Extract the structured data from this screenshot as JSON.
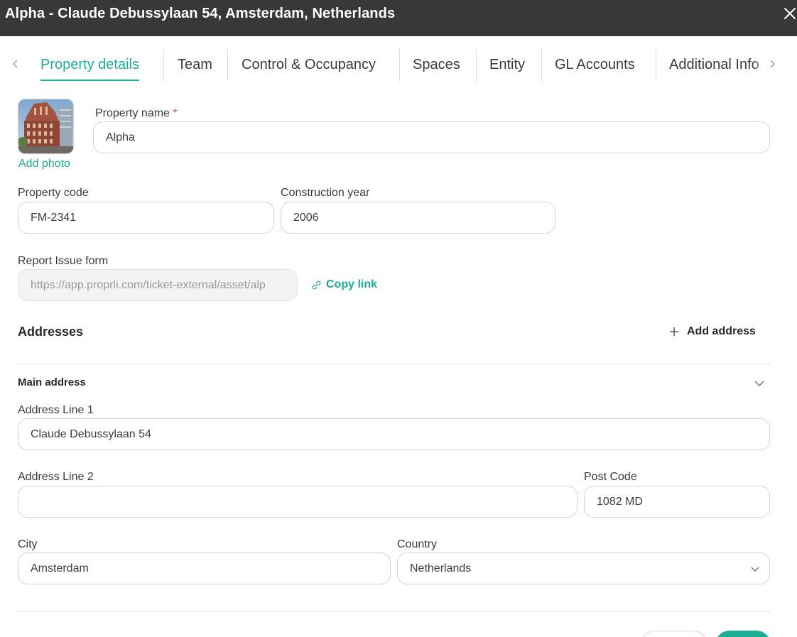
{
  "window": {
    "title": "Alpha - Claude Debussylaan 54, Amsterdam, Netherlands",
    "close_icon": "close-icon"
  },
  "tabs": [
    {
      "label": "Property details",
      "active": true
    },
    {
      "label": "Team",
      "active": false
    },
    {
      "label": "Control & Occupancy",
      "active": false
    },
    {
      "label": "Spaces",
      "active": false
    },
    {
      "label": "Entity",
      "active": false
    },
    {
      "label": "GL Accounts",
      "active": false
    },
    {
      "label": "Additional Info",
      "active": false
    }
  ],
  "photo": {
    "add_label": "Add photo"
  },
  "property_name": {
    "label": "Property name",
    "required_mark": "*",
    "value": "Alpha"
  },
  "property_code": {
    "label": "Property code",
    "value": "FM-2341"
  },
  "construction_year": {
    "label": "Construction year",
    "value": "2006"
  },
  "report_issue": {
    "label": "Report Issue form",
    "value": "https://app.proprli.com/ticket-external/asset/alp",
    "copy_label": "Copy link"
  },
  "addresses": {
    "title": "Addresses",
    "add_label": "Add address",
    "main": {
      "title": "Main address",
      "line1_label": "Address Line 1",
      "line1_value": "Claude Debussylaan 54",
      "line2_label": "Address Line 2",
      "line2_value": "",
      "postcode_label": "Post Code",
      "postcode_value": "1082 MD",
      "city_label": "City",
      "city_value": "Amsterdam",
      "country_label": "Country",
      "country_value": "Netherlands"
    }
  },
  "colors": {
    "accent": "#1aaf95",
    "titlebar": "#383838",
    "required": "#e05656"
  }
}
